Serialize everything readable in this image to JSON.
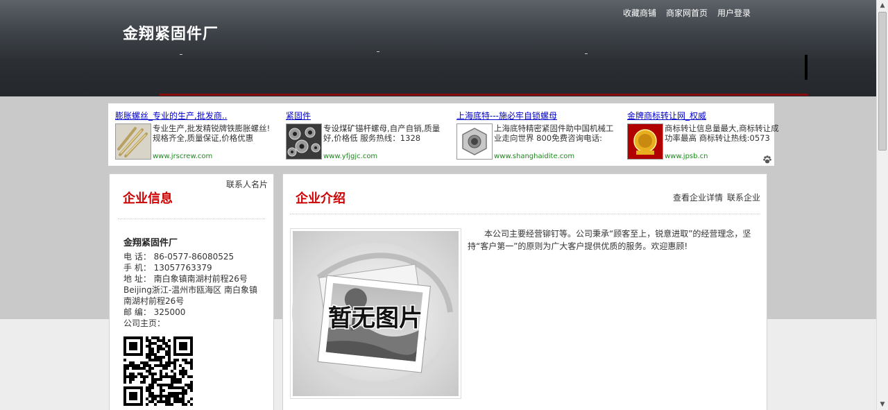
{
  "header": {
    "site_title": "金翔紧固件厂",
    "links": [
      "收藏商铺",
      "商家网首页",
      "用户登录"
    ]
  },
  "ads": [
    {
      "title": "膨胀螺丝_专业的生产,批发商..",
      "desc": "专业生产,批发精锐牌铁膨胀螺丝!规格齐全,质量保证,价格优惠",
      "url": "www.jrscrew.com",
      "icon": "screw-photo"
    },
    {
      "title": "紧固件",
      "desc": "专设煤矿锚杆螺母,自产自销,质量好,价格低 服务热线：1328",
      "url": "www.yfjgjc.com",
      "icon": "nuts-photo"
    },
    {
      "title": "上海底特---施必牢自锁螺母",
      "desc": "上海底特精密紧固件助中国机械工业走向世界 800免费咨询电话:",
      "url": "www.shanghaidite.com",
      "icon": "hex-nut-photo"
    },
    {
      "title": "金牌商标转让网_权威",
      "desc": "商标转让信息量最大,商标转让成功率最高 商标转让热线:0573",
      "url": "www.jpsb.cn",
      "icon": "gold-badge-logo"
    }
  ],
  "left_panel": {
    "tab_label": "联系人名片",
    "heading": "企业信息",
    "company_name": "金翔紧固件厂",
    "info_lines": [
      "电 话： 86-0577-86080525",
      "手 机： 13057763379",
      "地 址： 南白象镇南湖村前程26号Beijing浙江-温州市瓯海区 南白象镇南湖村前程26号",
      "邮 编： 325000",
      "公司主页："
    ]
  },
  "right_panel": {
    "heading": "企业介绍",
    "link_detail": "查看企业详情",
    "link_contact": "联系企业",
    "no_image_text": "暂无图片",
    "intro": "本公司主要经营铆钉等。公司秉承“顾客至上，锐意进取”的经营理念，坚持“客户第一”的原则为广大客户提供优质的服务。欢迎惠顾!"
  },
  "colors": {
    "accent_red": "#cc0000",
    "ad_link": "#0000cc",
    "ad_url": "#1a8a1a"
  }
}
